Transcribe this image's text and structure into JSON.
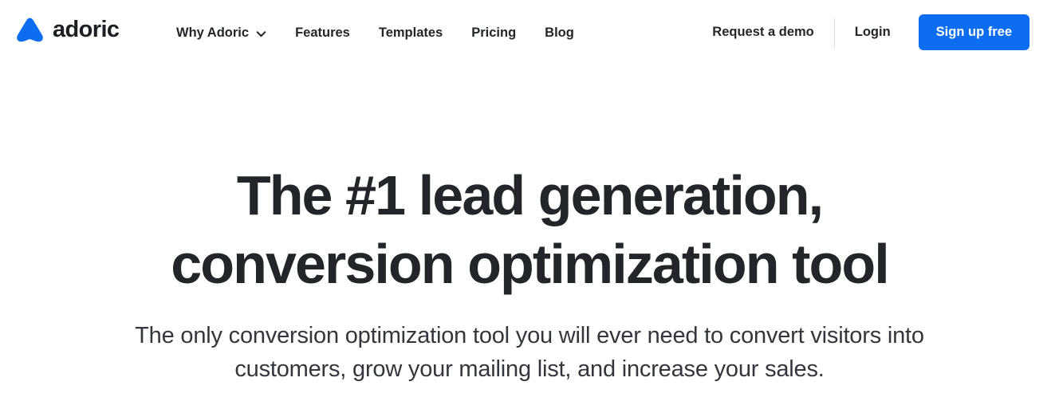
{
  "brand": {
    "name": "adoric",
    "logo_icon": "triangle-logo-icon",
    "color": "#0c6df0"
  },
  "nav": {
    "items": [
      {
        "label": "Why Adoric",
        "has_dropdown": true,
        "icon": "chevron-down-icon"
      },
      {
        "label": "Features",
        "has_dropdown": false
      },
      {
        "label": "Templates",
        "has_dropdown": false
      },
      {
        "label": "Pricing",
        "has_dropdown": false
      },
      {
        "label": "Blog",
        "has_dropdown": false
      }
    ],
    "actions": {
      "request_demo": "Request a demo",
      "login": "Login",
      "signup": "Sign up free"
    }
  },
  "hero": {
    "title_line1": "The #1 lead generation,",
    "title_line2": "conversion optimization tool",
    "subtitle_line1": "The only conversion optimization tool you will ever need to convert",
    "subtitle_line2": "visitors into customers, grow your mailing list, and increase your sales."
  },
  "colors": {
    "accent": "#0c6df0",
    "text_dark": "#22262b",
    "text_body": "#33373d",
    "divider": "#d8dbe0",
    "background": "#ffffff"
  }
}
